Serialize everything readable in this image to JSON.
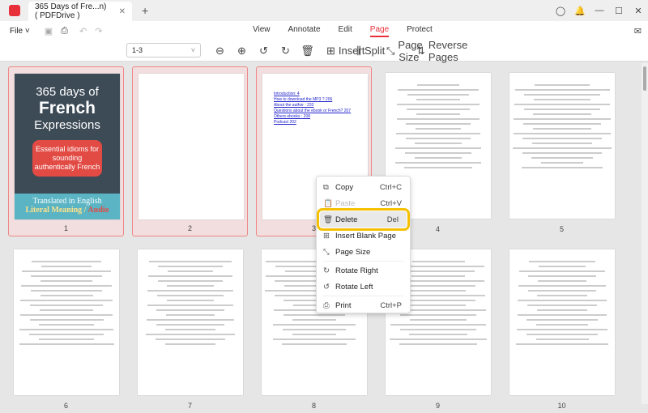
{
  "tab": {
    "title": "365 Days of Fre...n) ( PDFDrive )",
    "close": "✕",
    "new": "+"
  },
  "menu": {
    "file": "File",
    "tabs": [
      "View",
      "Annotate",
      "Edit",
      "Page",
      "Protect"
    ],
    "active": "Page"
  },
  "toolbar": {
    "range": "1-3",
    "insert": "Insert",
    "split": "Split",
    "page_size": "Page Size",
    "reverse": "Reverse Pages"
  },
  "cover": {
    "line1": "365 days of",
    "line2": "French",
    "line3": "Expressions",
    "bubble": "Essential idioms for sounding authentically French",
    "trans": "Translated in English",
    "sub1": "Literal Meaning / ",
    "sub2": "Audio"
  },
  "toc": [
    "Introduction: 4",
    "How to download the MP3 ? 206",
    "About the author : 232",
    "Questions about the ebook or French? 207",
    "Others ebooks : 208",
    "Podcast 202"
  ],
  "pages": [
    "1",
    "2",
    "3",
    "4",
    "5",
    "6",
    "7",
    "8",
    "9",
    "10"
  ],
  "context_menu": [
    {
      "label": "Copy",
      "shortcut": "Ctrl+C",
      "icon": "copy-icon",
      "glyph": "⧉"
    },
    {
      "label": "Paste",
      "shortcut": "Ctrl+V",
      "icon": "paste-icon",
      "glyph": "📋",
      "disabled": true
    },
    {
      "label": "Delete",
      "shortcut": "Del",
      "icon": "trash-icon",
      "glyph": "🗑"
    },
    {
      "label": "Insert Blank Page",
      "shortcut": "",
      "icon": "insert-page-icon",
      "glyph": "⊞"
    },
    {
      "label": "Page Size",
      "shortcut": "",
      "icon": "page-size-icon",
      "glyph": "⤡"
    },
    {
      "label": "Rotate Right",
      "shortcut": "",
      "icon": "rotate-right-icon",
      "glyph": "↻"
    },
    {
      "label": "Rotate Left",
      "shortcut": "",
      "icon": "rotate-left-icon",
      "glyph": "↺"
    },
    {
      "label": "Print",
      "shortcut": "Ctrl+P",
      "icon": "print-icon",
      "glyph": "⎙"
    }
  ],
  "selected_pages": [
    "1",
    "2",
    "3"
  ]
}
